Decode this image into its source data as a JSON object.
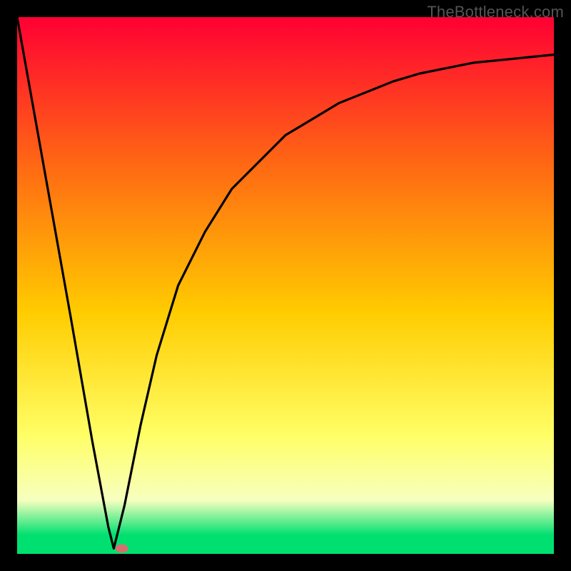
{
  "watermark": "TheBottleneck.com",
  "colors": {
    "top": "#ff0033",
    "mid_upper": "#ff6a13",
    "mid": "#ffcc00",
    "mid_lower": "#ffff66",
    "pale": "#f7ffbf",
    "green": "#00e070",
    "curve": "#000000",
    "marker": "#d86e6e",
    "frame": "#000000"
  },
  "chart_data": {
    "type": "line",
    "title": "",
    "xlabel": "",
    "ylabel": "",
    "xlim": [
      0,
      100
    ],
    "ylim": [
      0,
      100
    ],
    "notch_x": 18,
    "marker": {
      "x": 19.5,
      "y": 1.0
    },
    "series": [
      {
        "name": "bottleneck-curve",
        "x": [
          0,
          5,
          10,
          14,
          17,
          18,
          20,
          23,
          26,
          30,
          35,
          40,
          45,
          50,
          55,
          60,
          65,
          70,
          75,
          80,
          85,
          90,
          95,
          100
        ],
        "y": [
          100,
          72,
          44,
          21,
          5,
          1,
          9,
          24,
          37,
          50,
          60,
          68,
          73,
          78,
          81,
          84,
          86,
          88,
          89.5,
          90.5,
          91.5,
          92,
          92.5,
          93
        ]
      }
    ],
    "gradient_stops": [
      {
        "offset": 0.0,
        "key": "top"
      },
      {
        "offset": 0.28,
        "key": "mid_upper"
      },
      {
        "offset": 0.55,
        "key": "mid"
      },
      {
        "offset": 0.78,
        "key": "mid_lower"
      },
      {
        "offset": 0.9,
        "key": "pale"
      },
      {
        "offset": 0.965,
        "key": "green"
      },
      {
        "offset": 1.0,
        "key": "green"
      }
    ]
  }
}
